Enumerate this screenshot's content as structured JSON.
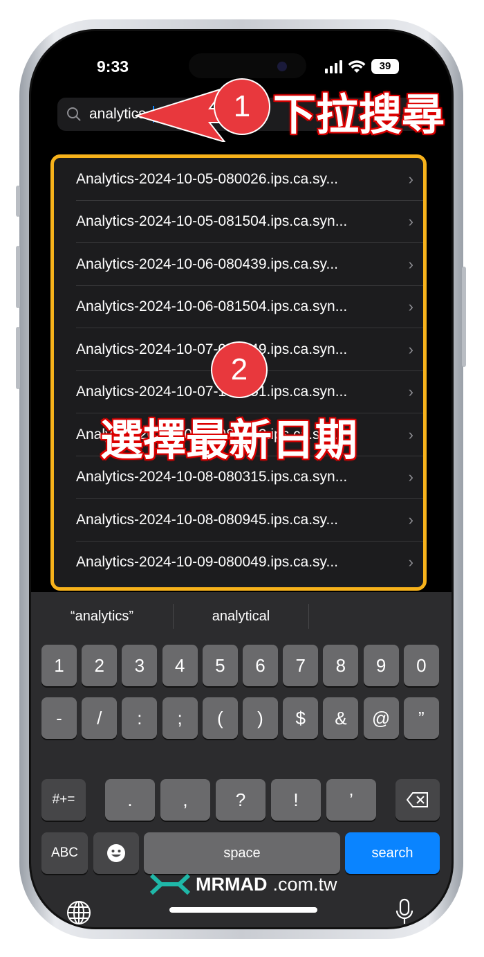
{
  "status_bar": {
    "time": "9:33",
    "battery": "39"
  },
  "search": {
    "value": "analytics"
  },
  "files": [
    "Analytics-2024-10-05-080026.ips.ca.sy...",
    "Analytics-2024-10-05-081504.ips.ca.syn...",
    "Analytics-2024-10-06-080439.ips.ca.sy...",
    "Analytics-2024-10-06-081504.ips.ca.syn...",
    "Analytics-2024-10-07-080049.ips.ca.syn...",
    "Analytics-2024-10-07-104151.ips.ca.syn...",
    "Analytics-2024-10-07-081503.ips.ca.sy...",
    "Analytics-2024-10-08-080315.ips.ca.syn...",
    "Analytics-2024-10-08-080945.ips.ca.sy...",
    "Analytics-2024-10-09-080049.ips.ca.sy..."
  ],
  "suggestions": [
    "“analytics”",
    "analytical"
  ],
  "keyboard": {
    "row1": [
      "1",
      "2",
      "3",
      "4",
      "5",
      "6",
      "7",
      "8",
      "9",
      "0"
    ],
    "row2": [
      "-",
      "/",
      ":",
      ";",
      "(",
      ")",
      "$",
      "&",
      "@",
      "”"
    ],
    "row3": [
      ".",
      ",",
      "?",
      "!",
      "’"
    ],
    "symbols": "#+=",
    "abc": "ABC",
    "space": "space",
    "search": "search"
  },
  "annotations": {
    "step1": "1",
    "step1_text": "下拉搜尋",
    "step2": "2",
    "step2_text": "選擇最新日期",
    "arrow_color": "#e8383d",
    "highlight_color": "#f7b21b"
  },
  "watermark": {
    "brand": "MRMAD",
    "domain": ".com.tw"
  }
}
